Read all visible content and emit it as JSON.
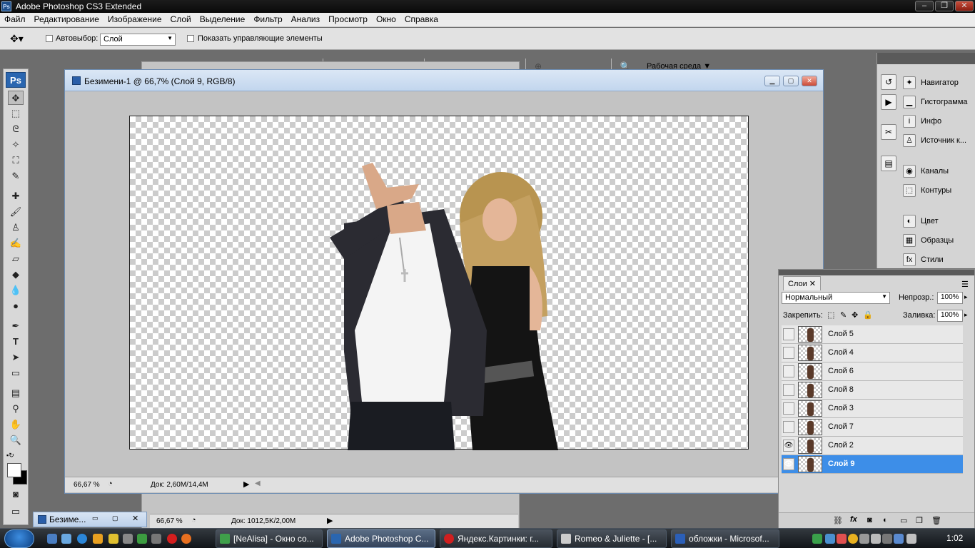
{
  "app": {
    "title": "Adobe Photoshop CS3 Extended",
    "logo": "Ps"
  },
  "menu": [
    "Файл",
    "Редактирование",
    "Изображение",
    "Слой",
    "Выделение",
    "Фильтр",
    "Анализ",
    "Просмотр",
    "Окно",
    "Справка"
  ],
  "options": {
    "autoselect_label": "Автовыбор:",
    "autoselect_value": "Слой",
    "show_controls_label": "Показать управляющие элементы",
    "workspace_label": "Рабочая среда"
  },
  "document": {
    "title": "Безимени-1 @ 66,7% (Слой 9, RGB/8)",
    "zoom": "66,67 %",
    "doc_size": "Док: 2,60M/14,4M"
  },
  "back_document": {
    "tab_title": "Безиме...",
    "zoom": "66,67 %",
    "doc_size": "Док: 1012,5K/2,00M"
  },
  "panels": {
    "group1": [
      "Навигатор",
      "Гистограмма",
      "Инфо",
      "Источник к..."
    ],
    "group2": [
      "Каналы",
      "Контуры"
    ],
    "group3": [
      "Цвет",
      "Образцы",
      "Стили"
    ]
  },
  "layers_panel": {
    "tab": "Слои",
    "blend_mode": "Нормальный",
    "opacity_label": "Непрозр.:",
    "opacity_value": "100%",
    "lock_label": "Закрепить:",
    "fill_label": "Заливка:",
    "fill_value": "100%",
    "layers": [
      {
        "name": "Слой 5",
        "visible": false,
        "active": false
      },
      {
        "name": "Слой 4",
        "visible": false,
        "active": false
      },
      {
        "name": "Слой 6",
        "visible": false,
        "active": false
      },
      {
        "name": "Слой 8",
        "visible": false,
        "active": false
      },
      {
        "name": "Слой 3",
        "visible": false,
        "active": false
      },
      {
        "name": "Слой 7",
        "visible": false,
        "active": false
      },
      {
        "name": "Слой 2",
        "visible": true,
        "active": false
      },
      {
        "name": "Слой 9",
        "visible": true,
        "active": true
      }
    ]
  },
  "taskbar": {
    "tasks": [
      {
        "label": "[NeAlisa] - Окно со...",
        "color": "#3fa04a"
      },
      {
        "label": "Adobe Photoshop C...",
        "color": "#2a66b0"
      },
      {
        "label": "Яндекс.Картинки: г...",
        "color": "#d11f1f"
      },
      {
        "label": "Romeo & Juliette - [...",
        "color": "#cccccc"
      },
      {
        "label": "обложки - Microsof...",
        "color": "#2b5fb8"
      }
    ],
    "clock": "1:02"
  },
  "colors": {
    "accent": "#3d8ee8",
    "titlebar": "#111111"
  }
}
